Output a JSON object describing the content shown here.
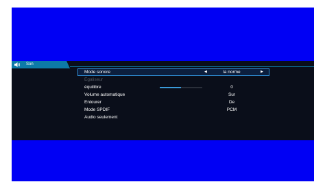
{
  "colors": {
    "screen_bg": "#0000f4",
    "panel_bg": "#0a0e1a",
    "accent": "#0d7aa7",
    "selected_border": "#2f8fd6",
    "slider_fill": "#3a9ad9",
    "disabled_text": "#545a63"
  },
  "tab": {
    "icon": "speaker-icon",
    "label": "Son"
  },
  "menu": {
    "items": [
      {
        "label": "Mode sonore",
        "value": "la norme",
        "selected": true,
        "has_arrows": true
      },
      {
        "label": "Égaliseur",
        "value": "",
        "disabled": true
      },
      {
        "label": "équilibre",
        "value": "0",
        "slider_fraction": 0.5
      },
      {
        "label": "Volume automatique",
        "value": "Sur"
      },
      {
        "label": "Entourer",
        "value": "De"
      },
      {
        "label": "Mode SPDIF",
        "value": "PCM"
      },
      {
        "label": "Audio seulement",
        "value": ""
      }
    ]
  }
}
